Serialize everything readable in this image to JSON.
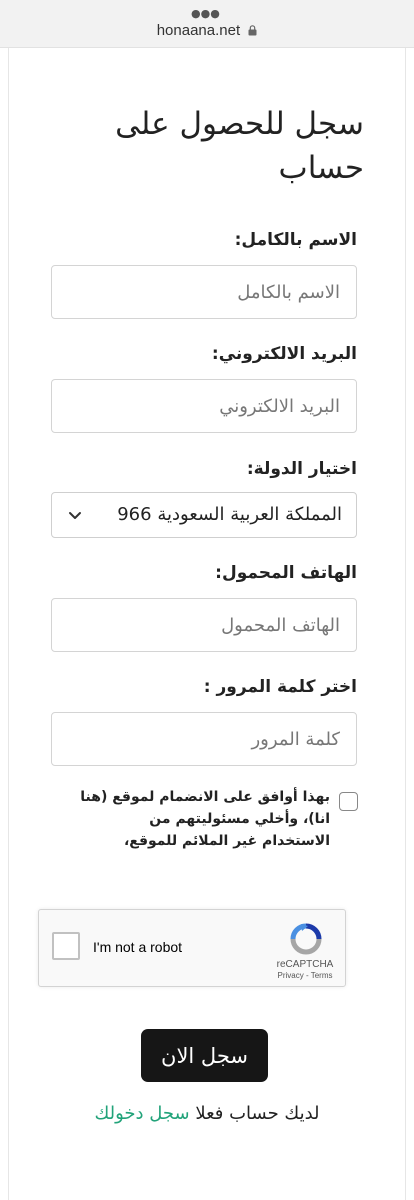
{
  "browser": {
    "url": "honaana.net"
  },
  "form": {
    "title": "سجل للحصول على حساب",
    "full_name": {
      "label": "الاسم بالكامل:",
      "placeholder": "الاسم بالكامل"
    },
    "email": {
      "label": "البريد الالكتروني:",
      "placeholder": "البريد الالكتروني"
    },
    "country": {
      "label": "اختيار الدولة:",
      "selected": "المملكة العربية السعودية 966"
    },
    "mobile": {
      "label": "الهاتف المحمول:",
      "placeholder": "الهاتف المحمول"
    },
    "password": {
      "label": "اختر كلمة المرور :",
      "placeholder": "كلمة المرور"
    },
    "terms": {
      "text": "بهذا أوافق على الانضمام لموقع (هنا انا)، وأخلي مسئوليتهم من الاستخدام غير الملائم للموقع،",
      "checked": false
    },
    "captcha": {
      "label": "I'm not a robot",
      "brand": "reCAPTCHA",
      "privacy": "Privacy",
      "separator": "-",
      "terms": "Terms"
    },
    "submit_label": "سجل الان",
    "login": {
      "prompt": "لديك حساب فعلا",
      "link": "سجل دخولك"
    }
  },
  "colors": {
    "accent_link": "#22a37a",
    "button_bg": "#161616"
  }
}
